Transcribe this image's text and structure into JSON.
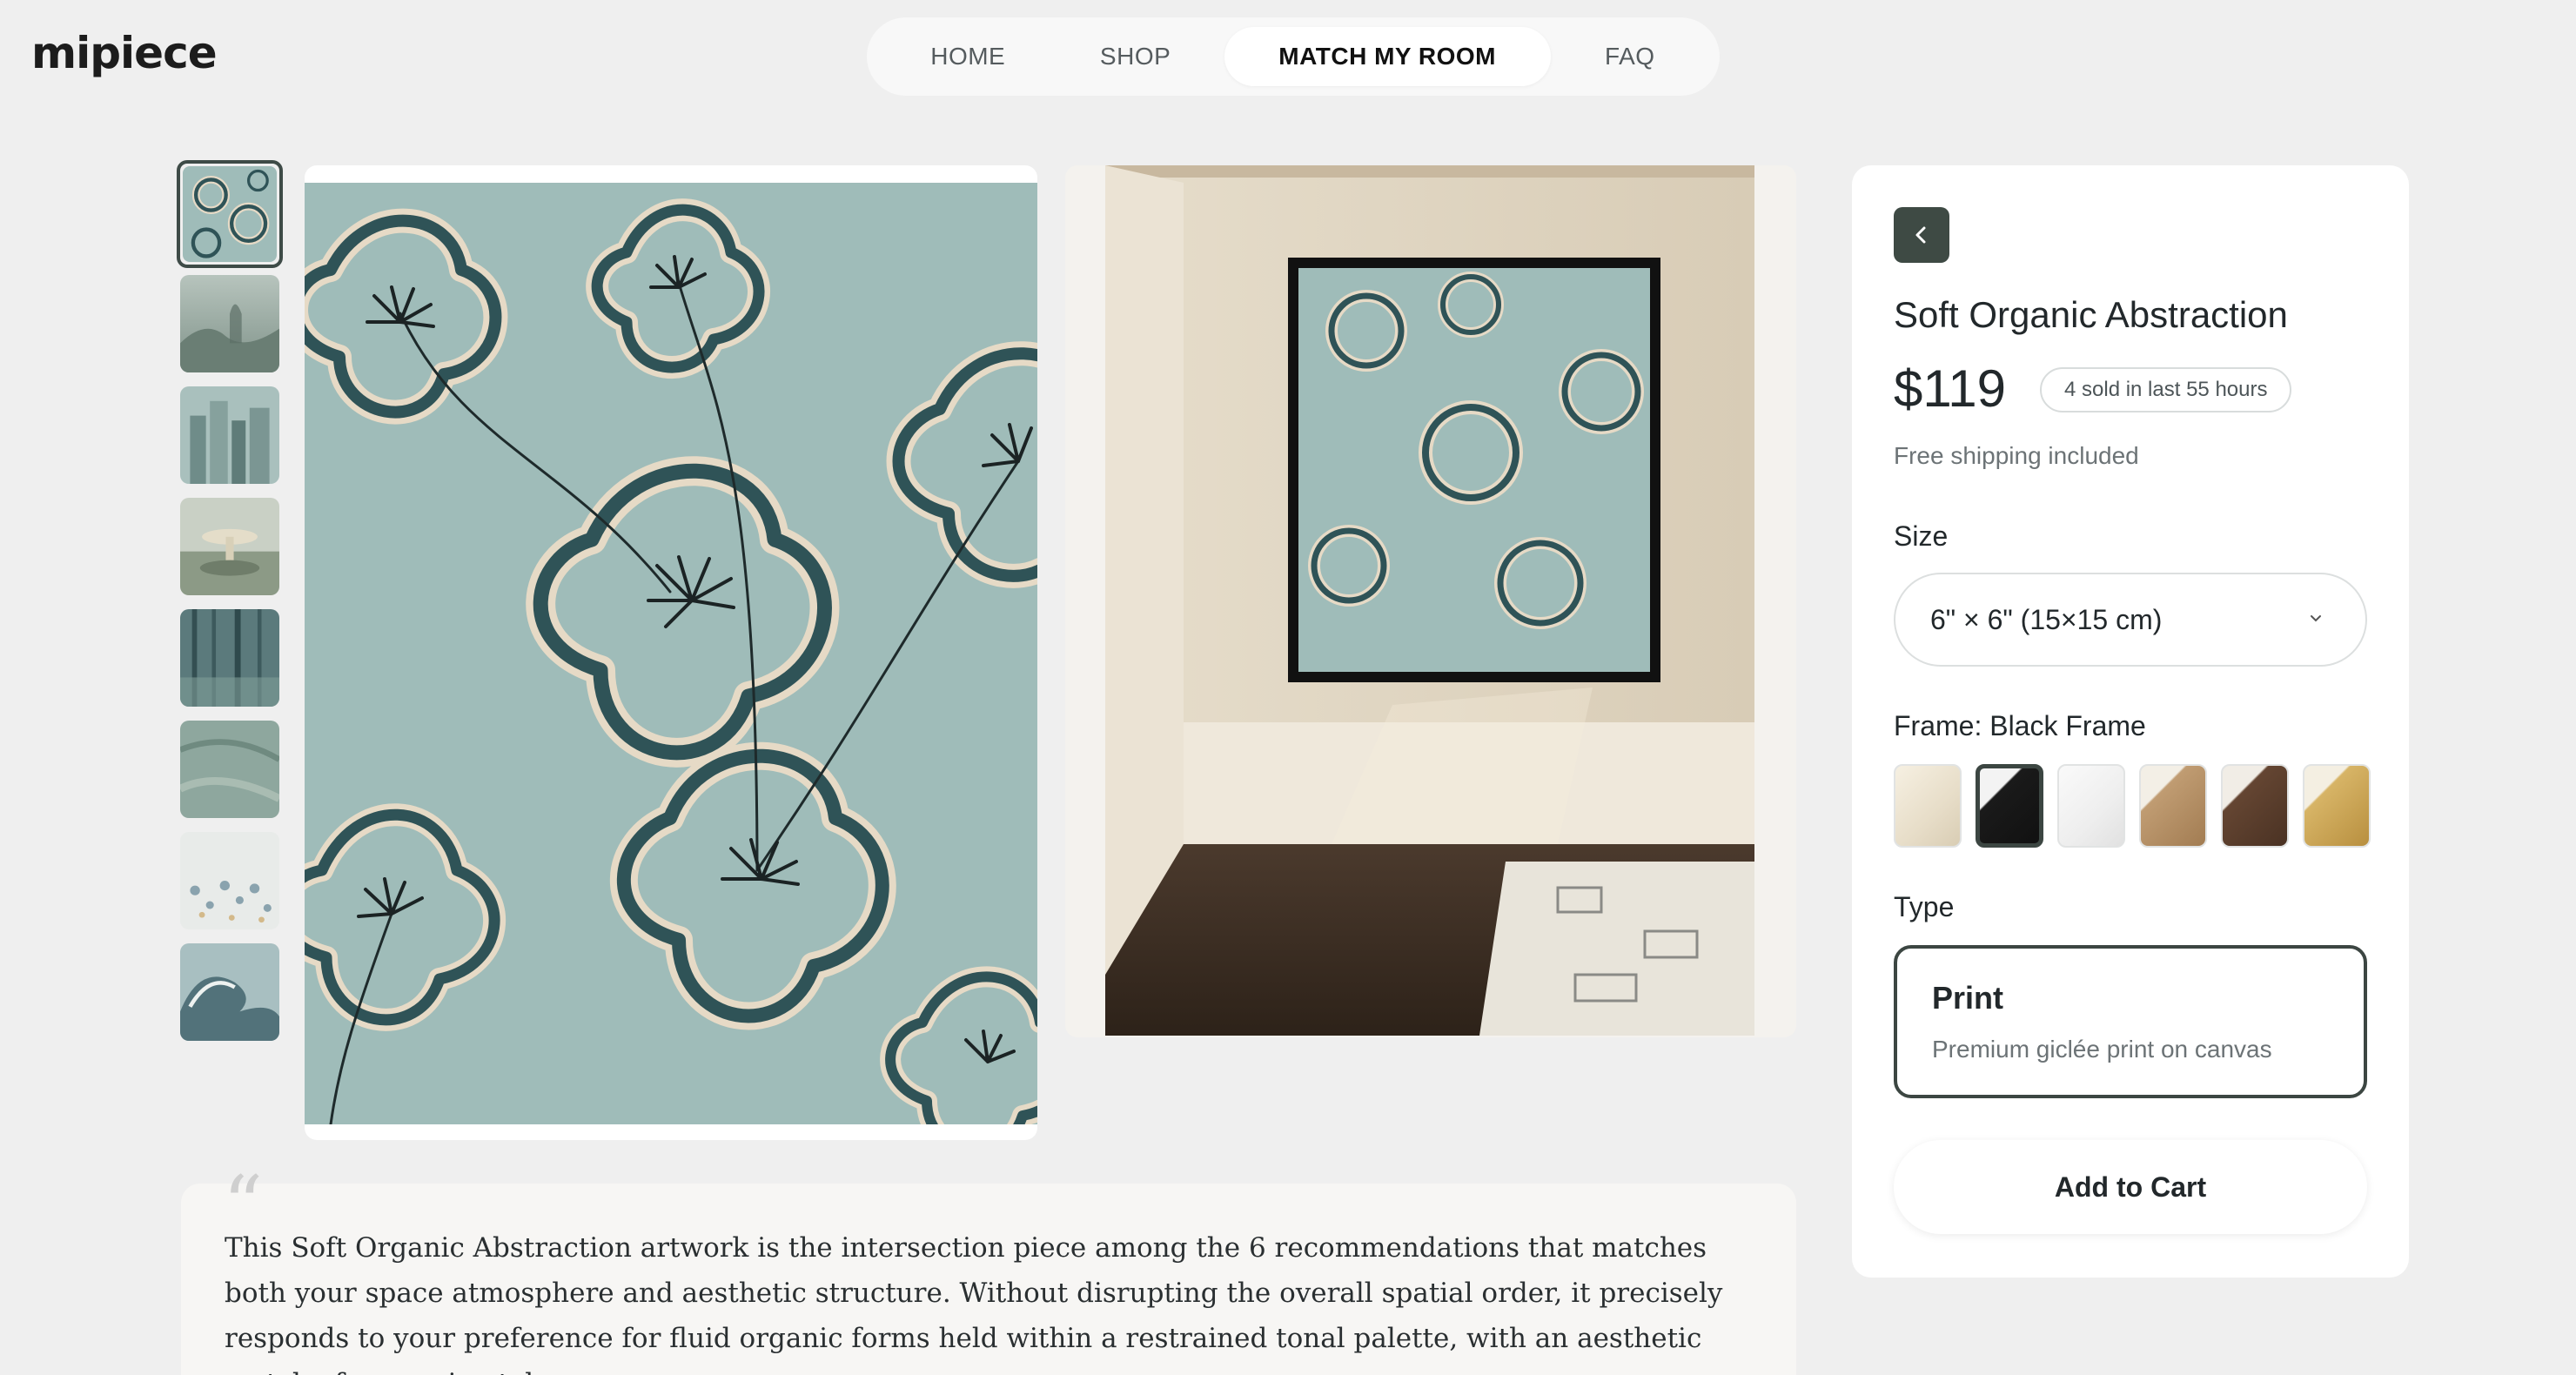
{
  "brand": {
    "logo": "mipiece"
  },
  "nav": {
    "items": [
      {
        "label": "HOME"
      },
      {
        "label": "SHOP"
      },
      {
        "label": "MATCH MY ROOM",
        "active": true
      },
      {
        "label": "FAQ"
      }
    ]
  },
  "gallery": {
    "thumbnails": [
      {
        "name": "floral-abstraction",
        "active": true
      },
      {
        "name": "misty-landscape"
      },
      {
        "name": "city-skyline"
      },
      {
        "name": "surreal-fountain"
      },
      {
        "name": "forest"
      },
      {
        "name": "textured-green"
      },
      {
        "name": "floral-dots"
      },
      {
        "name": "wave"
      }
    ]
  },
  "product": {
    "title": "Soft Organic Abstraction",
    "price": "$119",
    "sold_badge": "4 sold in last 55 hours",
    "shipping": "Free shipping included",
    "size_label": "Size",
    "size_value": "6\" × 6\" (15×15 cm)",
    "frame_label": "Frame: Black Frame",
    "frames": [
      {
        "name": "cream",
        "color": "#efe8d8"
      },
      {
        "name": "black",
        "color": "#1a1a1a",
        "active": true
      },
      {
        "name": "white",
        "color": "#f1f1f1"
      },
      {
        "name": "natural-wood",
        "color": "#b8946a"
      },
      {
        "name": "dark-wood",
        "color": "#5a3e2c"
      },
      {
        "name": "gold",
        "color": "#c9a55a"
      }
    ],
    "type_label": "Type",
    "type_title": "Print",
    "type_sub": "Premium giclée print on canvas",
    "cart_label": "Add to Cart"
  },
  "quote": {
    "text": "This Soft Organic Abstraction artwork is the intersection piece among the 6 recommendations that matches both your space atmosphere and aesthetic structure. Without disrupting the overall spatial order, it precisely responds to your preference for fluid organic forms held within a restrained tonal palette, with an aesthetic match of approximately"
  },
  "colors": {
    "accent": "#3e4a44",
    "art_bg": "#9fbcb9",
    "petal_dark": "#2f5357",
    "petal_light": "#e6dac6"
  }
}
